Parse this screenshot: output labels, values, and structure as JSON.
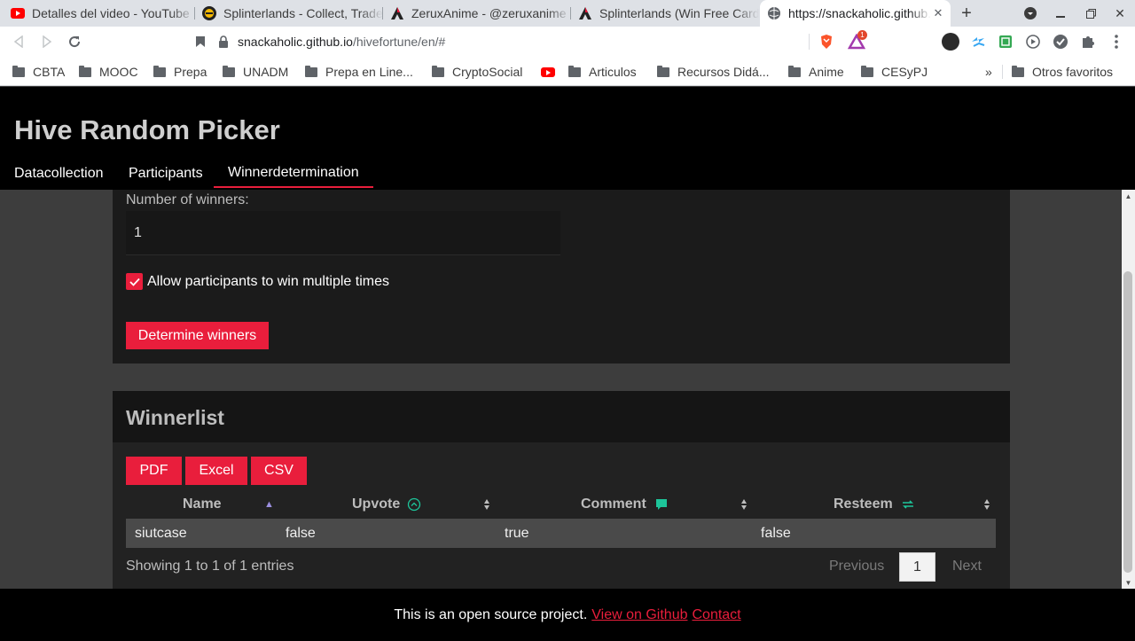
{
  "browser": {
    "tabs": [
      {
        "title": "Detalles del video - YouTube",
        "icon": "youtube-icon"
      },
      {
        "title": "Splinterlands - Collect, Trade",
        "icon": "splinterlands-icon"
      },
      {
        "title": "ZeruxAnime - @zeruxanime",
        "icon": "hive-icon"
      },
      {
        "title": "Splinterlands (Win Free Cards)",
        "icon": "hive-icon"
      },
      {
        "title": "https://snackaholic.github.io",
        "icon": "globe-icon"
      }
    ],
    "new_tab": "+",
    "url_host": "snackaholic.github.io",
    "url_path": "/hivefortune/en/#",
    "bookmarks": [
      "CBTA",
      "MOOC",
      "Prepa",
      "UNADM",
      "Prepa en Line...",
      "CryptoSocial",
      "",
      "Articulos",
      "Recursos Didá...",
      "Anime",
      "CESyPJ"
    ],
    "bookmarks_more": "»",
    "other_bookmarks": "Otros favoritos",
    "brave_badge": "1"
  },
  "site": {
    "title": "Hive Random Picker",
    "tabs": [
      "Datacollection",
      "Participants",
      "Winnerdetermination"
    ],
    "active_tab": "Winnerdetermination"
  },
  "determination": {
    "number_label": "Number of winners:",
    "number_value": "1",
    "allow_multiple_label": "Allow participants to win multiple times",
    "allow_multiple_checked": true,
    "determine_button": "Determine winners"
  },
  "winnerlist": {
    "title": "Winnerlist",
    "export_buttons": [
      "PDF",
      "Excel",
      "CSV"
    ],
    "columns": [
      "Name",
      "Upvote",
      "Comment",
      "Resteem"
    ],
    "rows": [
      [
        "siutcase",
        "false",
        "true",
        "false"
      ]
    ],
    "info": "Showing 1 to 1 of 1 entries",
    "pagination": {
      "previous": "Previous",
      "current": "1",
      "next": "Next"
    }
  },
  "footer": {
    "text": "This is an open source project.",
    "github_link": "View on Github",
    "contact_link": "Contact"
  },
  "colors": {
    "accent": "#e91e3c",
    "header_bg": "#000000",
    "card_bg": "#1b1b1b",
    "page_bg": "#3d3d3d",
    "comment_icon": "#1dc59a"
  }
}
